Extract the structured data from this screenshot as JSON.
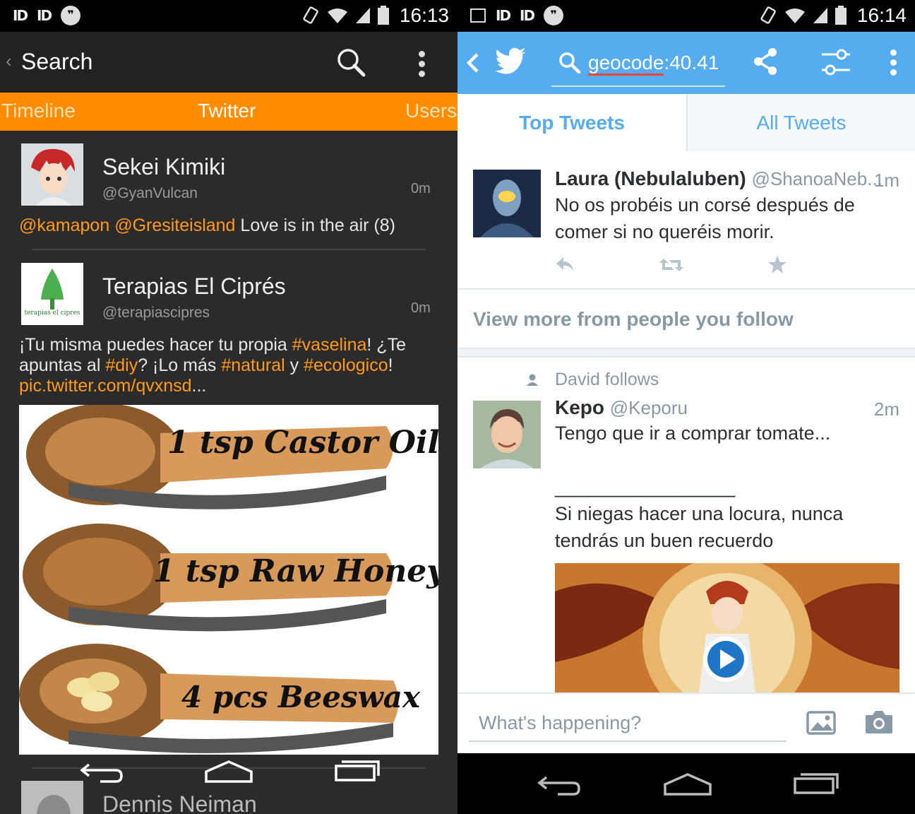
{
  "left": {
    "status": {
      "time": "16:13"
    },
    "appbar": {
      "back_label": "‹",
      "title": "Search"
    },
    "tabs": [
      {
        "label": "Timeline"
      },
      {
        "label": "Twitter"
      },
      {
        "label": "Users"
      }
    ],
    "tweets": [
      {
        "name": "Sekei Kimiki",
        "handle": "@GyanVulcan",
        "time": "0m",
        "text_parts": [
          "@kamapon",
          " ",
          "@Gresiteisland",
          " Love is in the air (8)"
        ]
      },
      {
        "name": "Terapias El Ciprés",
        "handle": "@terapiascipres",
        "time": "0m",
        "avatar_caption": "terapias el cipres",
        "text_parts": [
          "¡Tu misma puedes hacer tu propia ",
          "#vaselina",
          "! ¿Te",
          "apuntas al ",
          "#diy",
          "? ¡Lo más ",
          "#natural",
          " y ",
          "#ecologico",
          "!",
          "pic.twitter.com/qvxnsd",
          "..."
        ],
        "image_captions": [
          "1 tsp Castor Oil",
          "1 tsp Raw Honey",
          "4 pcs Beeswax"
        ]
      },
      {
        "name": "Dennis Neiman"
      }
    ]
  },
  "right": {
    "status": {
      "time": "16:14"
    },
    "search": {
      "query_prefix": "geocode",
      "query_suffix": ":40.41"
    },
    "tabs": [
      {
        "label": "Top Tweets"
      },
      {
        "label": "All Tweets"
      }
    ],
    "tweets": [
      {
        "name": "Laura (Nebulaluben)",
        "handle": "@ShanoaNeb...",
        "time": "1m",
        "text_line1": "No os probéis un corsé después de",
        "text_line2": "comer si no queréis morir."
      },
      {
        "follows": "David follows",
        "name": "Kepo",
        "handle": "@Keporu",
        "time": "2m",
        "text_line1": "Tengo que ir a comprar tomate...",
        "text_line2": "_________________",
        "text_line3": " Si niegas hacer una locura, nunca",
        "text_line4": "tendrás un buen recuerdo"
      }
    ],
    "view_more": "View more from people you follow",
    "composer": {
      "placeholder": "What's happening?"
    }
  },
  "colors": {
    "twitter_blue": "#55acee",
    "orange_accent": "#ff8c00",
    "highlight_orange": "#ff9a1e"
  }
}
